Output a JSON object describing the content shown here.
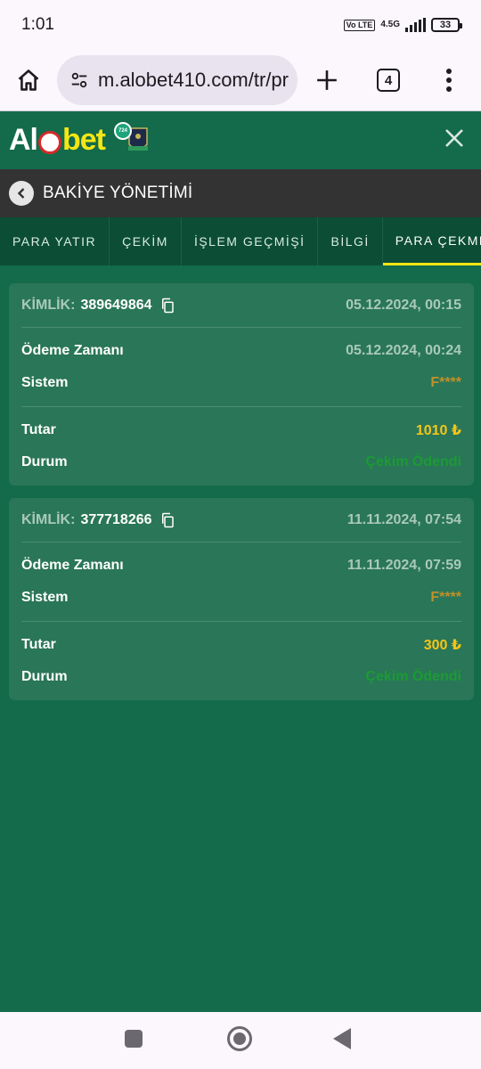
{
  "status_bar": {
    "time": "1:01",
    "volte": "Vo LTE",
    "network": "4.5G",
    "battery": "33"
  },
  "browser": {
    "url": "m.alobet410.com/tr/pr",
    "tab_count": "4"
  },
  "site": {
    "logo_al": "Al",
    "logo_bet": "bet",
    "logo_badge": "724",
    "section_title": "BAKİYE YÖNETİMİ"
  },
  "nav_tabs": [
    {
      "label": "PARA YATIR"
    },
    {
      "label": "ÇEKİM"
    },
    {
      "label": "İŞLEM GEÇMİŞİ"
    },
    {
      "label": "BİLGİ"
    },
    {
      "label": "PARA ÇEKME DU"
    }
  ],
  "labels": {
    "id": "KİMLİK:",
    "payment_time": "Ödeme Zamanı",
    "system": "Sistem",
    "amount": "Tutar",
    "status": "Durum"
  },
  "withdrawals": [
    {
      "id": "389649864",
      "created": "05.12.2024, 00:15",
      "payment_time": "05.12.2024, 00:24",
      "system": "F****",
      "amount": "1010 ₺",
      "status": "Çekim Ödendi"
    },
    {
      "id": "377718266",
      "created": "11.11.2024, 07:54",
      "payment_time": "11.11.2024, 07:59",
      "system": "F****",
      "amount": "300 ₺",
      "status": "Çekim Ödendi"
    }
  ],
  "colors": {
    "site_bg": "#136b4b",
    "card_bg": "#2a7658",
    "accent_yellow": "#f5e614",
    "status_green": "#1c9a35",
    "system_orange": "#c0902a"
  }
}
